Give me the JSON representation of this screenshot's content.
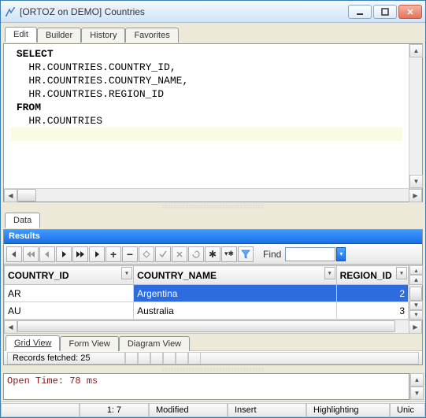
{
  "window": {
    "title": "[ORTOZ on DEMO] Countries"
  },
  "editor_tabs": [
    "Edit",
    "Builder",
    "History",
    "Favorites"
  ],
  "editor_active_tab": 0,
  "sql": {
    "l1_kw": "SELECT",
    "l2": "HR.COUNTRIES.COUNTRY_ID,",
    "l3": "HR.COUNTRIES.COUNTRY_NAME,",
    "l4": "HR.COUNTRIES.REGION_ID",
    "l5_kw": "FROM",
    "l6": "HR.COUNTRIES"
  },
  "data_tab": "Data",
  "results_label": "Results",
  "toolbar_icons": [
    "|◀",
    "◀◀",
    "◀",
    "▶",
    "▶▶",
    "▶|",
    "+",
    "−",
    "▲",
    "✓",
    "×",
    "↻",
    "✱",
    "▼",
    "funnel"
  ],
  "find_label": "Find",
  "grid": {
    "columns": [
      "COUNTRY_ID",
      "COUNTRY_NAME",
      "REGION_ID"
    ],
    "rows": [
      {
        "COUNTRY_ID": "AR",
        "COUNTRY_NAME": "Argentina",
        "REGION_ID": "2",
        "selected": true
      },
      {
        "COUNTRY_ID": "AU",
        "COUNTRY_NAME": "Australia",
        "REGION_ID": "3",
        "selected": false
      }
    ]
  },
  "view_tabs": [
    "Grid View",
    "Form View",
    "Diagram View"
  ],
  "records_fetched": "Records fetched: 25",
  "log": "Open Time: 78 ms",
  "statusbar": {
    "pos": "1:  7",
    "modified": "Modified",
    "insert": "Insert",
    "highlighting": "Highlighting",
    "unicode": "Unic"
  }
}
